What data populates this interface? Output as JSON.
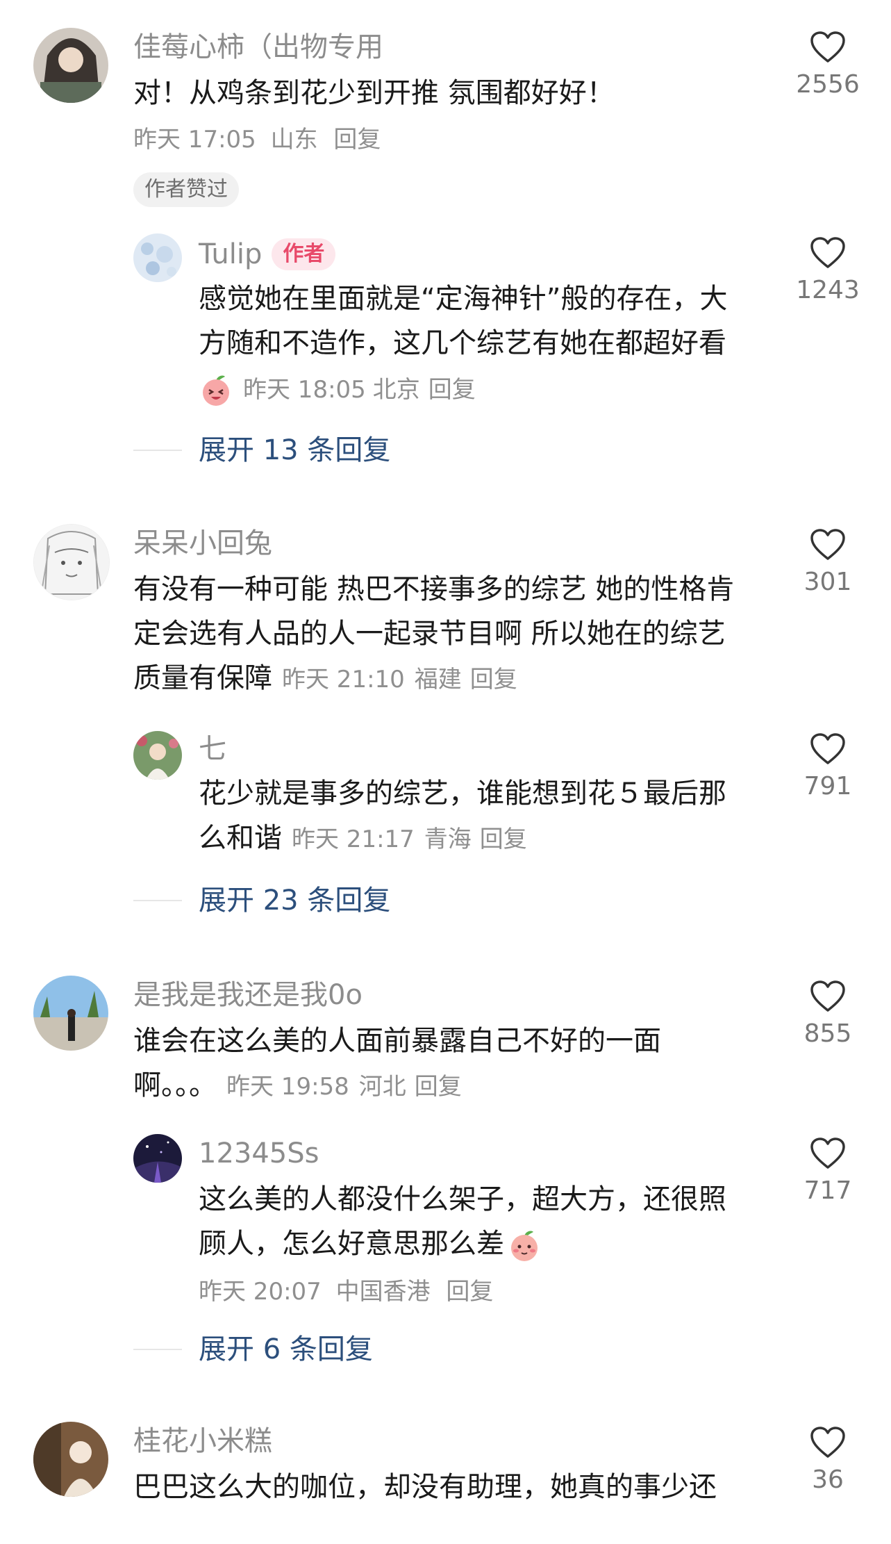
{
  "comments": [
    {
      "username": "佳莓心柿（出物专用",
      "text": "对！从鸡条到花少到开推  氛围都好好！",
      "time": "昨天 17:05",
      "location": "山东",
      "reply_label": "回复",
      "likes": "2556",
      "badge": "作者赞过",
      "replies": [
        {
          "username": "Tulip",
          "badge": "作者",
          "line1": "感觉她在里面就是“定海神针”般的存在，大",
          "line2": "方随和不造作，这几个综艺有她在都超好看",
          "time": "昨天 18:05",
          "location": "北京",
          "reply_label": "回复",
          "likes": "1243",
          "emoji": "peach-laugh-emoji"
        }
      ],
      "expand_label": "展开 13 条回复"
    },
    {
      "username": "呆呆小回兔",
      "line1": "有没有一种可能 热巴不接事多的综艺 她的性格肯",
      "line2": "定会选有人品的人一起录节目啊 所以她在的综艺",
      "line3": "质量有保障",
      "time": "昨天 21:10",
      "location": "福建",
      "reply_label": "回复",
      "likes": "301",
      "replies": [
        {
          "username": "七",
          "line1": "花少就是事多的综艺，谁能想到花５最后那",
          "line2": "么和谐",
          "time": "昨天 21:17",
          "location": "青海",
          "reply_label": "回复",
          "likes": "791"
        }
      ],
      "expand_label": "展开 23 条回复"
    },
    {
      "username": "是我是我还是我0o",
      "line1": "谁会在这么美的人面前暴露自己不好的一面",
      "line2": "啊。。。",
      "time": "昨天 19:58",
      "location": "河北",
      "reply_label": "回复",
      "likes": "855",
      "replies": [
        {
          "username": "12345Ss",
          "line1": "这么美的人都没什么架子，超大方，还很照",
          "line2": "顾人，怎么好意思那么差",
          "time": "昨天 20:07",
          "location": "中国香港",
          "reply_label": "回复",
          "likes": "717",
          "emoji": "peach-blush-emoji"
        }
      ],
      "expand_label": "展开 6 条回复"
    },
    {
      "username": "桂花小米糕",
      "line1": "巴巴这么大的咖位，却没有助理，她真的事少还",
      "likes": "36"
    }
  ],
  "colors": {
    "username": "#8c8c8c",
    "meta": "#8f8f8f",
    "expand_link": "#2c4f7c",
    "author_badge_bg": "#fde7ec",
    "author_badge_text": "#e84a6a",
    "heart_stroke": "#333333"
  }
}
